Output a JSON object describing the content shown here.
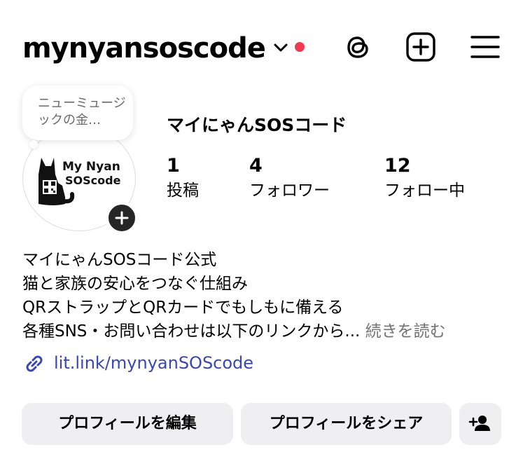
{
  "header": {
    "username": "mynyansoscode",
    "icons": [
      "chevron-down-icon",
      "threads-icon",
      "create-post-icon",
      "menu-icon"
    ],
    "notification_color": "#ef3b4f"
  },
  "profile": {
    "note_text": "ニューミュージックの金…",
    "avatar_text_line1": "My Nyan",
    "avatar_text_line2": "SOScode",
    "display_name": "マイにゃんSOSコード",
    "stats": [
      {
        "value": "1",
        "label": "投稿"
      },
      {
        "value": "4",
        "label": "フォロワー"
      },
      {
        "value": "12",
        "label": "フォロー中"
      }
    ]
  },
  "bio": {
    "lines": [
      "マイにゃんSOSコード公式",
      "猫と家族の安心をつなぐ仕組み",
      "QRストラップとQRカードでもしもに備える",
      "各種SNS・お問い合わせは以下のリンクから..."
    ],
    "more": " 続きを読む"
  },
  "link": {
    "text": "lit.link/mynyanSOScode",
    "color": "#3b46b5"
  },
  "actions": {
    "edit_label": "プロフィールを編集",
    "share_label": "プロフィールをシェア",
    "add_person_icon": "add-person-icon"
  }
}
